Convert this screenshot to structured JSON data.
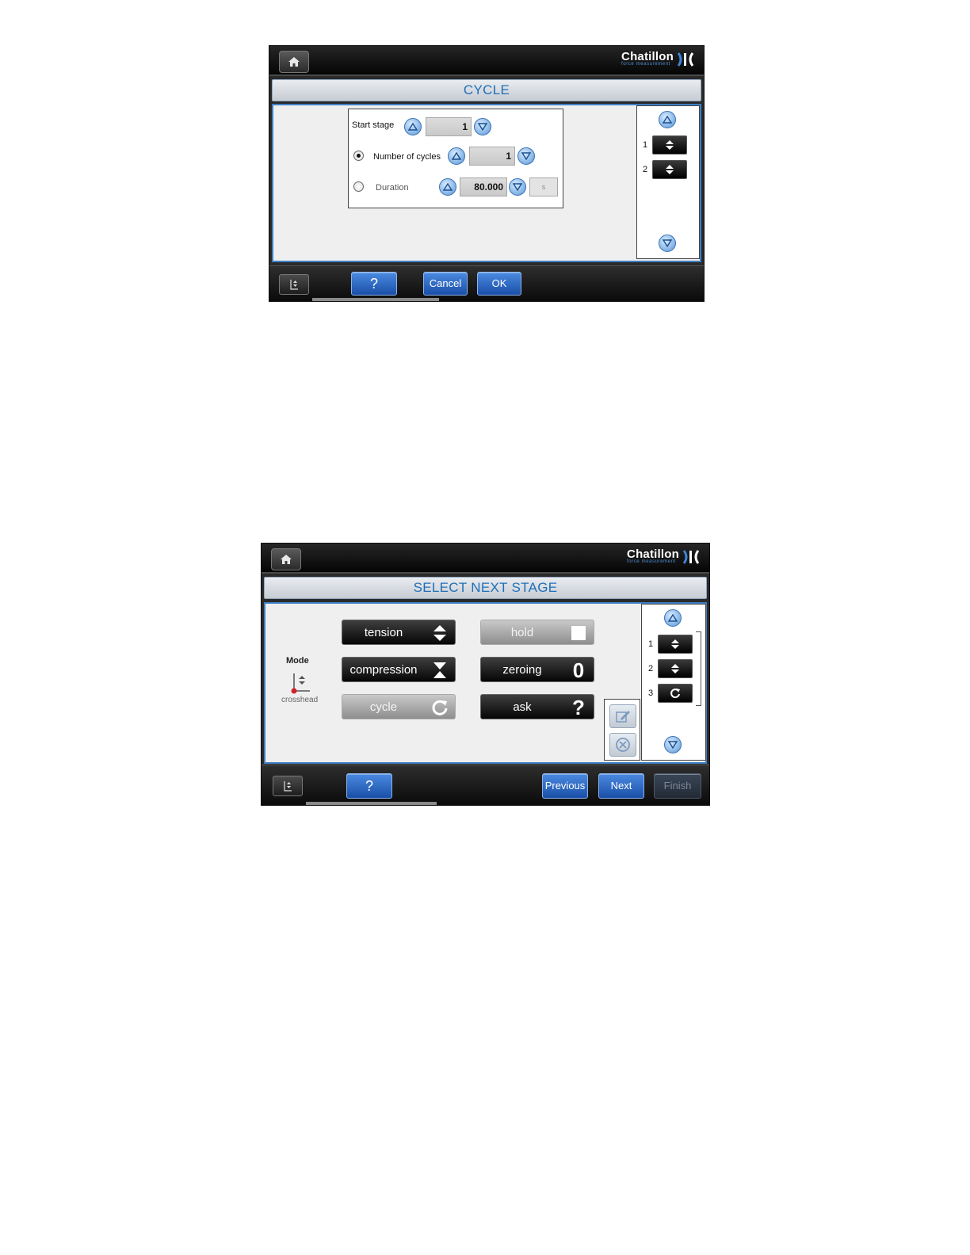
{
  "brand": {
    "name": "Chatillon",
    "tagline": "force measurement"
  },
  "colors": {
    "accent": "#1f6fb8",
    "button_blue": "#2a63c2",
    "topbar": "#0a0a0a",
    "content_border": "#3d7fc5"
  },
  "icons": {
    "home": "home-icon",
    "up": "up-arrow-circle-icon",
    "down": "down-arrow-circle-icon",
    "updown": "up-down-arrows-icon",
    "cycle": "cycle-icon",
    "edit": "edit-icon",
    "delete": "delete-icon"
  },
  "cycle_screen": {
    "title": "CYCLE",
    "start_stage": {
      "label": "Start stage",
      "value": "1"
    },
    "number_of_cycles": {
      "label": "Number of cycles",
      "value": "1",
      "selected": true
    },
    "duration": {
      "label": "Duration",
      "value": "80.000",
      "unit": "s",
      "selected": false
    },
    "stages": [
      {
        "number": "1",
        "icon": "up-down-arrows-icon"
      },
      {
        "number": "2",
        "icon": "up-down-arrows-icon"
      }
    ],
    "buttons": {
      "help": "?",
      "cancel": "Cancel",
      "ok": "OK"
    }
  },
  "select_stage_screen": {
    "title": "SELECT NEXT STAGE",
    "mode": {
      "label": "Mode",
      "value": "crosshead"
    },
    "stage_types": {
      "tension": "tension",
      "compression": "compression",
      "cycle": "cycle",
      "hold": "hold",
      "zeroing": "zeroing",
      "zeroing_glyph": "0",
      "ask": "ask",
      "ask_glyph": "?"
    },
    "stages": [
      {
        "number": "1",
        "icon": "up-down-arrows-icon"
      },
      {
        "number": "2",
        "icon": "up-down-arrows-icon"
      },
      {
        "number": "3",
        "icon": "cycle-icon"
      }
    ],
    "buttons": {
      "help": "?",
      "previous": "Previous",
      "next": "Next",
      "finish": "Finish"
    }
  }
}
